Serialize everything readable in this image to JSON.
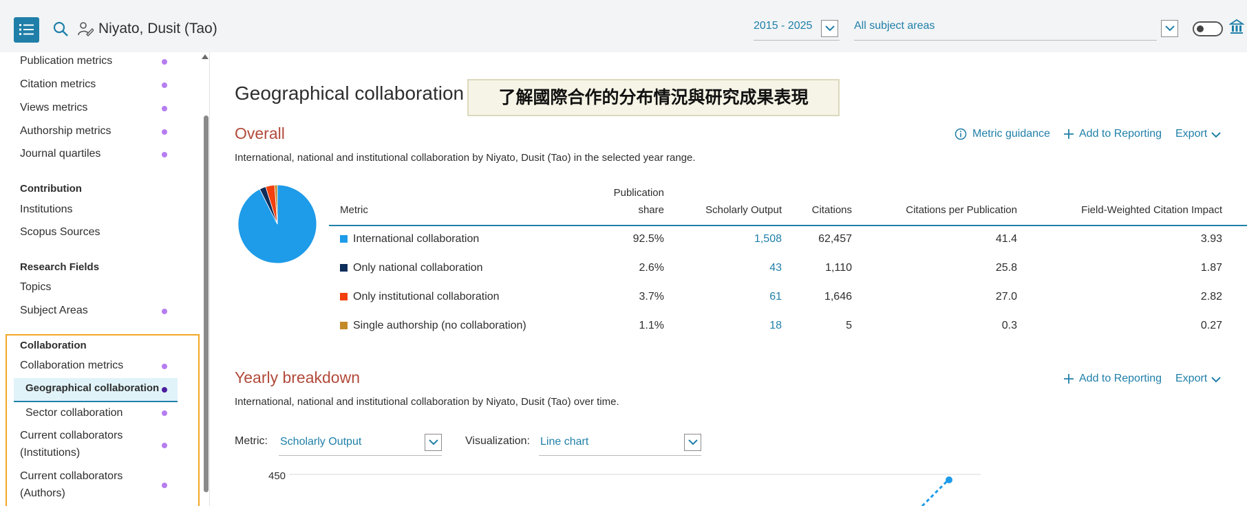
{
  "topbar": {
    "author": "Niyato, Dusit (Tao)",
    "year_range": "2015 - 2025",
    "subject_area": "All subject areas"
  },
  "sidebar": {
    "items_top": [
      "Publication metrics",
      "Citation metrics",
      "Views metrics",
      "Authorship metrics",
      "Journal quartiles"
    ],
    "contribution_heading": "Contribution",
    "contribution_items": [
      "Institutions",
      "Scopus Sources"
    ],
    "research_heading": "Research Fields",
    "research_items": [
      "Topics",
      "Subject Areas"
    ],
    "collab_heading": "Collaboration",
    "collab_items": [
      "Collaboration metrics",
      "Geographical collaboration",
      "Sector collaboration"
    ],
    "current_inst": [
      "Current collaborators",
      "(Institutions)"
    ],
    "current_auth": [
      "Current collaborators",
      "(Authors)"
    ]
  },
  "main": {
    "title": "Geographical collaboration",
    "banner": "了解國際合作的分布情況與研究成果表現",
    "overall_title": "Overall",
    "overall_desc": "International, national and institutional collaboration by Niyato, Dusit (Tao) in the selected year range.",
    "metric_guidance": "Metric guidance",
    "add_to_reporting": "Add to Reporting",
    "export": "Export",
    "table": {
      "headers": {
        "metric": "Metric",
        "share_1": "Publication",
        "share_2": "share",
        "output": "Scholarly Output",
        "citations": "Citations",
        "cpp": "Citations per Publication",
        "fwci": "Field-Weighted Citation Impact"
      },
      "rows": [
        {
          "metric": "International collaboration",
          "share": "92.5%",
          "output": "1,508",
          "citations": "62,457",
          "cpp": "41.4",
          "fwci": "3.93",
          "color": "#1e9be9"
        },
        {
          "metric": "Only national collaboration",
          "share": "2.6%",
          "output": "43",
          "citations": "1,110",
          "cpp": "25.8",
          "fwci": "1.87",
          "color": "#0d2d5a"
        },
        {
          "metric": "Only institutional collaboration",
          "share": "3.7%",
          "output": "61",
          "citations": "1,646",
          "cpp": "27.0",
          "fwci": "2.82",
          "color": "#f2400e"
        },
        {
          "metric": "Single authorship (no collaboration)",
          "share": "1.1%",
          "output": "18",
          "citations": "5",
          "cpp": "0.3",
          "fwci": "0.27",
          "color": "#c48a28"
        }
      ]
    },
    "yearly_title": "Yearly breakdown",
    "yearly_desc": "International, national and institutional collaboration by Niyato, Dusit (Tao) over time.",
    "metric_label": "Metric:",
    "metric_value": "Scholarly Output",
    "viz_label": "Visualization:",
    "viz_value": "Line chart",
    "chart_tick": "450"
  },
  "chart_data": {
    "type": "pie",
    "labels": [
      "International collaboration",
      "Only national collaboration",
      "Only institutional collaboration",
      "Single authorship (no collaboration)"
    ],
    "values": [
      92.5,
      2.6,
      3.7,
      1.1
    ],
    "colors": [
      "#1e9be9",
      "#0d2d5a",
      "#f2400e",
      "#c48a28"
    ]
  }
}
